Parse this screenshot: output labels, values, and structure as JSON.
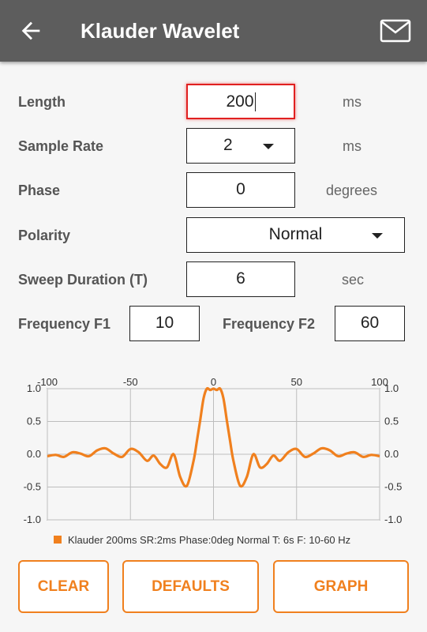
{
  "app_bar": {
    "title": "Klauder Wavelet",
    "back_icon": "arrow-back-icon",
    "mail_icon": "mail-icon",
    "background": "#5d5d5d"
  },
  "form": {
    "length": {
      "label": "Length",
      "value": "200",
      "unit": "ms"
    },
    "sample_rate": {
      "label": "Sample Rate",
      "value": "2",
      "unit": "ms"
    },
    "phase": {
      "label": "Phase",
      "value": "0",
      "unit": "degrees"
    },
    "polarity": {
      "label": "Polarity",
      "value": "Normal"
    },
    "sweep_duration": {
      "label": "Sweep Duration (T)",
      "value": "6",
      "unit": "sec"
    },
    "frequency_f1": {
      "label": "Frequency F1",
      "value": "10"
    },
    "frequency_f2": {
      "label": "Frequency F2",
      "value": "60"
    }
  },
  "chart_data": {
    "type": "line",
    "x_ticks": [
      "-100",
      "-50",
      "0",
      "50",
      "100"
    ],
    "x_tick_values": [
      -100,
      -50,
      0,
      50,
      100
    ],
    "y_ticks": [
      "1.0",
      "0.5",
      "0.0",
      "-0.5",
      "-1.0"
    ],
    "y_tick_values": [
      1.0,
      0.5,
      0.0,
      -0.5,
      -1.0
    ],
    "xlim": [
      -100,
      100
    ],
    "ylim": [
      -1.0,
      1.0
    ],
    "grid": true,
    "legend_position": "bottom",
    "series": [
      {
        "name": "Klauder 200ms SR:2ms Phase:0deg Normal T: 6s F: 10-60 Hz",
        "color": "#f0801e",
        "x": [
          -100,
          -95,
          -90,
          -85,
          -80,
          -75,
          -70,
          -65,
          -60,
          -55,
          -50,
          -45,
          -40,
          -36,
          -32,
          -28,
          -24,
          -20,
          -16,
          -12,
          -10,
          -8,
          -6,
          -4,
          -2,
          0,
          2,
          4,
          6,
          8,
          10,
          12,
          16,
          20,
          24,
          28,
          32,
          36,
          40,
          45,
          50,
          55,
          60,
          65,
          70,
          75,
          80,
          85,
          90,
          95,
          100
        ],
        "y": [
          -0.03,
          -0.01,
          -0.04,
          0.03,
          0.01,
          -0.03,
          0.06,
          0.09,
          0.01,
          -0.04,
          0.08,
          0.03,
          -0.1,
          -0.02,
          -0.15,
          -0.2,
          0.0,
          -0.35,
          -0.48,
          -0.1,
          0.2,
          0.52,
          0.85,
          1.0,
          0.98,
          1.0,
          0.98,
          1.0,
          0.85,
          0.52,
          0.2,
          -0.1,
          -0.48,
          -0.35,
          0.0,
          -0.2,
          -0.15,
          -0.02,
          -0.1,
          0.03,
          0.08,
          -0.04,
          0.01,
          0.09,
          0.06,
          -0.03,
          0.01,
          0.03,
          -0.04,
          -0.01,
          -0.03
        ]
      }
    ]
  },
  "buttons": {
    "clear": "CLEAR",
    "defaults": "DEFAULTS",
    "graph": "GRAPH"
  },
  "colors": {
    "accent": "#f0801e",
    "focus_border": "#e02020"
  }
}
